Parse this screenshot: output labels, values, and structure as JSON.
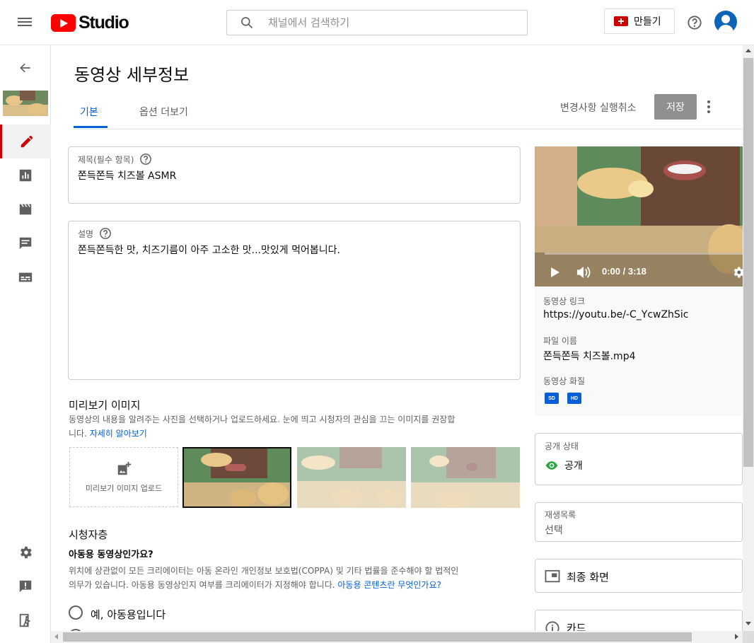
{
  "header": {
    "logo_text": "Studio",
    "search_placeholder": "채널에서 검색하기",
    "create_label": "만들기"
  },
  "page": {
    "title": "동영상 세부정보",
    "tabs": [
      {
        "label": "기본",
        "active": true
      },
      {
        "label": "옵션 더보기",
        "active": false
      }
    ],
    "undo_label": "변경사항 실행취소",
    "save_label": "저장"
  },
  "form": {
    "title_label": "제목(필수 항목)",
    "title_value": "쫀득쫀득 치즈볼 ASMR",
    "description_label": "설명",
    "description_value": "쫀득쫀득한 맛, 치즈기름이 아주 고소한 맛...맛있게 먹어봅니다."
  },
  "thumbnail": {
    "heading": "미리보기 이미지",
    "desc_line1": "동영상의 내용을 알려주는 사진을 선택하거나 업로드하세요. 눈에 띄고 시청자의 관심을 끄는 이미지를 권장합",
    "desc_line2_prefix": "니다. ",
    "learn_more": "자세히 알아보기",
    "upload_label": "미리보기 이미지 업로드"
  },
  "audience": {
    "heading": "시청자층",
    "question": "아동용 동영상인가요?",
    "desc_line1": "위치에 상관없이 모든 크리에이터는 아동 온라인 개인정보 보호법(COPPA) 및 기타 법률을 준수해야 할 법적인",
    "desc_line2_prefix": "의무가 있습니다. 아동용 동영상인지 여부를 크리에이터가 지정해야 합니다. ",
    "desc_link": "아동용 콘텐츠란 무엇인가요?",
    "option_yes": "예, 아동용입니다"
  },
  "video": {
    "time": "0:00 / 3:18",
    "link_label": "동영상 링크",
    "link_value": "https://youtu.be/-C_YcwZhSic",
    "filename_label": "파일 이름",
    "filename_value": "쫀득쫀득 치즈볼.mp4",
    "quality_label": "동영상 화질",
    "quality_badges": [
      "SD",
      "HD"
    ]
  },
  "visibility": {
    "label": "공개 상태",
    "value": "공개"
  },
  "playlist": {
    "label": "재생목록",
    "value": "선택"
  },
  "end_screen": {
    "label": "최종 화면"
  },
  "cards": {
    "label": "카드"
  },
  "colors": {
    "accent": "#065fd4",
    "brand_red": "#ff0000",
    "active_rail": "#cc0000",
    "public_green": "#2ba640"
  }
}
